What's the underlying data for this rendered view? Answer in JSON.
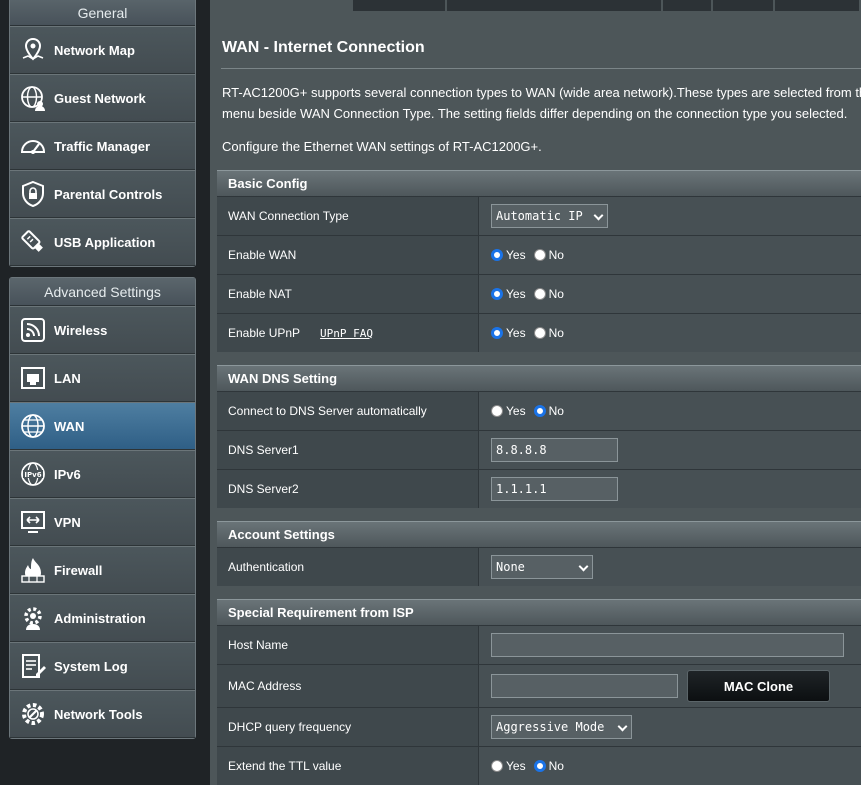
{
  "sidebar": {
    "general_title": "General",
    "general_items": [
      {
        "label": "Network Map",
        "icon": "network-map-icon"
      },
      {
        "label": "Guest Network",
        "icon": "guest-network-icon"
      },
      {
        "label": "Traffic Manager",
        "icon": "traffic-manager-icon"
      },
      {
        "label": "Parental Controls",
        "icon": "parental-controls-icon"
      },
      {
        "label": "USB Application",
        "icon": "usb-application-icon"
      }
    ],
    "advanced_title": "Advanced Settings",
    "advanced_items": [
      {
        "label": "Wireless",
        "icon": "wireless-icon"
      },
      {
        "label": "LAN",
        "icon": "lan-icon"
      },
      {
        "label": "WAN",
        "icon": "wan-globe-icon",
        "active": true
      },
      {
        "label": "IPv6",
        "icon": "ipv6-icon"
      },
      {
        "label": "VPN",
        "icon": "vpn-icon"
      },
      {
        "label": "Firewall",
        "icon": "firewall-icon"
      },
      {
        "label": "Administration",
        "icon": "administration-gear-icon"
      },
      {
        "label": "System Log",
        "icon": "system-log-icon"
      },
      {
        "label": "Network Tools",
        "icon": "network-tools-icon"
      }
    ]
  },
  "page": {
    "title": "WAN - Internet Connection",
    "desc_line1": "RT-AC1200G+ supports several connection types to WAN (wide area network).These types are selected from th",
    "desc_line2": "menu beside WAN Connection Type. The setting fields differ depending on the connection type you selected.",
    "desc_configure": "Configure the Ethernet WAN settings of RT-AC1200G+."
  },
  "basic_config": {
    "header": "Basic Config",
    "wan_connection_type_label": "WAN Connection Type",
    "wan_connection_type_value": "Automatic IP",
    "enable_wan_label": "Enable WAN",
    "enable_nat_label": "Enable NAT",
    "enable_upnp_label": "Enable UPnP",
    "upnp_faq_link": "UPnP FAQ"
  },
  "radio": {
    "yes": "Yes",
    "no": "No"
  },
  "dns": {
    "header": "WAN DNS Setting",
    "auto_label": "Connect to DNS Server automatically",
    "server1_label": "DNS Server1",
    "server1_value": "8.8.8.8",
    "server2_label": "DNS Server2",
    "server2_value": "1.1.1.1"
  },
  "account": {
    "header": "Account Settings",
    "auth_label": "Authentication",
    "auth_value": "None"
  },
  "isp": {
    "header": "Special Requirement from ISP",
    "host_name_label": "Host Name",
    "host_name_value": "",
    "mac_address_label": "MAC Address",
    "mac_address_value": "",
    "mac_clone_button": "MAC Clone",
    "dhcp_freq_label": "DHCP query frequency",
    "dhcp_freq_value": "Aggressive Mode",
    "ttl_label": "Extend the TTL value"
  },
  "colors": {
    "accent": "#1a73e8",
    "active_menu": "#3a6b92"
  }
}
